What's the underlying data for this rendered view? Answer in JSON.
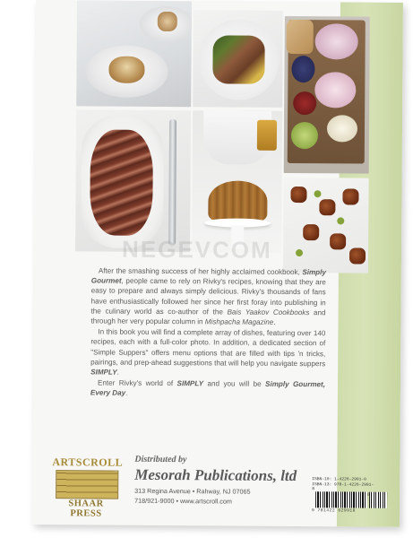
{
  "watermark": "NEGEVCOM",
  "blurb": {
    "p1_a": "After the smashing success of her highly acclaimed cookbook, ",
    "p1_title": "Simply Gourmet",
    "p1_b": ", people came to rely on Rivky's recipes, knowing that they are easy to prepare and always simply delicious. Rivky's thousands of fans have enthusiastically followed her since her first foray into publishing in the culinary world as co-author of the ",
    "p1_series": "Bais Yaakov Cookbooks",
    "p1_c": " and through her very popular column in ",
    "p1_magazine": "Mishpacha Magazine",
    "p1_d": ".",
    "p2": "In this book you will find a complete array of dishes, featuring over 140 recipes, each with a full-color photo. In addition, a dedicated section of \"Simple Suppers\" offers menu options that are filled with tips 'n tricks, pairings, and prep-ahead suggestions that will help you navigate suppers ",
    "p2_simply": "SIMPLY",
    "p2_end": ".",
    "p3_a": "Enter Rivky's world of ",
    "p3_simply": "SIMPLY",
    "p3_b": " and you will be ",
    "p3_title": "Simply Gourmet, Every Day",
    "p3_end": "."
  },
  "publisher_logo": {
    "top": "ARTSCROLL",
    "bottom": "SHAAR PRESS"
  },
  "distributor": {
    "label": "Distributed by",
    "name": "Mesorah Publications, ltd",
    "address": "313 Regina Avenue • Rahway, NJ 07065",
    "phone": "718/921-9000 • www.artscroll.com"
  },
  "isbn": {
    "isbn10": "ISBN-10: 1-4226-2991-0",
    "isbn13": "ISBN-13: 978-1-4226-2991-8",
    "price_code": "90000",
    "barcode_number": "9 781422 629918"
  }
}
